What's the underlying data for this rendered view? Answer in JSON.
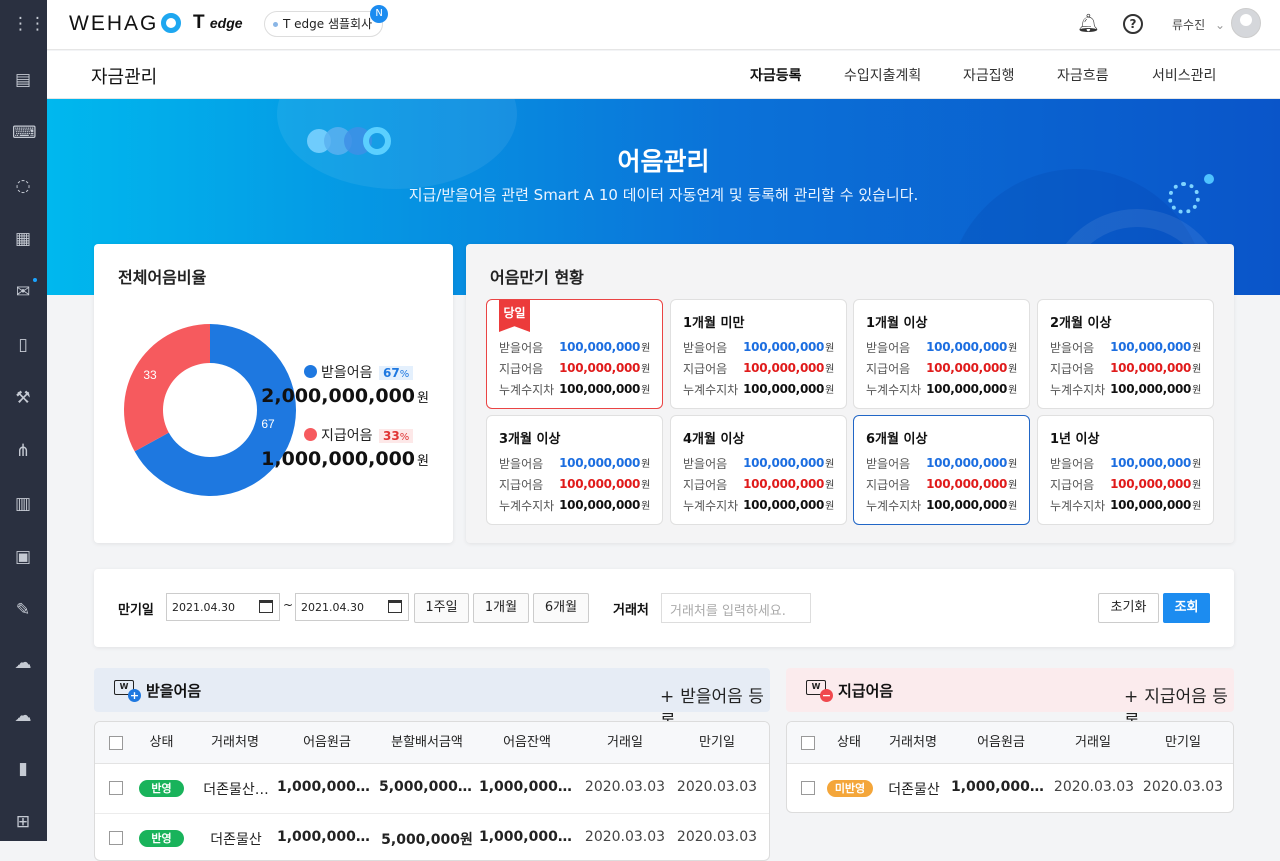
{
  "sidebar": {
    "icons": [
      "apps-icon",
      "report-icon",
      "keyboard-icon",
      "chat-icon",
      "calendar-icon",
      "mail-icon",
      "mobile-icon",
      "hammer-icon",
      "org-chart-icon",
      "building-icon",
      "contacts-icon",
      "book-edit-icon",
      "cloud-icon",
      "cloud-network-icon",
      "notebook-icon",
      "grid-menu-icon"
    ]
  },
  "topbar": {
    "logo": "WEHAG",
    "tedge": "T",
    "tedge_suffix": "edge",
    "company": "T edge 샘플회사",
    "company_badge": "N",
    "user_name": "류수진"
  },
  "subnav": {
    "title": "자금관리",
    "items": [
      "자금등록",
      "수입지출계획",
      "자금집행",
      "자금흐름",
      "서비스관리"
    ]
  },
  "hero": {
    "title": "어음관리",
    "subtitle": "지급/받을어음 관련 Smart A 10 데이터 자동연계 및 등록해 관리할 수 있습니다."
  },
  "ratio_card": {
    "title": "전체어음비율",
    "receivable": {
      "label": "받을어음",
      "percent": "67",
      "unit": "%",
      "amount": "2,000,000,000",
      "won": "원"
    },
    "payable": {
      "label": "지급어음",
      "percent": "33",
      "unit": "%",
      "amount": "1,000,000,000",
      "won": "원"
    },
    "donut_label_blue": "67",
    "donut_label_red": "33"
  },
  "chart_data": {
    "type": "pie",
    "title": "전체어음비율",
    "categories": [
      "받을어음",
      "지급어음"
    ],
    "values": [
      67,
      33
    ],
    "colors": [
      "#1e78e0",
      "#f65a5e"
    ]
  },
  "maturity": {
    "title": "어음만기 현황",
    "row_labels": {
      "receive": "받을어음",
      "pay": "지급어음",
      "cum": "누계수지차",
      "won": "원"
    },
    "cards": [
      {
        "label": "당일",
        "receive": "100,000,000",
        "pay": "100,000,000",
        "cum": "100,000,000"
      },
      {
        "label": "1개월 미만",
        "receive": "100,000,000",
        "pay": "100,000,000",
        "cum": "100,000,000"
      },
      {
        "label": "1개월 이상",
        "receive": "100,000,000",
        "pay": "100,000,000",
        "cum": "100,000,000"
      },
      {
        "label": "2개월 이상",
        "receive": "100,000,000",
        "pay": "100,000,000",
        "cum": "100,000,000"
      },
      {
        "label": "3개월 이상",
        "receive": "100,000,000",
        "pay": "100,000,000",
        "cum": "100,000,000"
      },
      {
        "label": "4개월 이상",
        "receive": "100,000,000",
        "pay": "100,000,000",
        "cum": "100,000,000"
      },
      {
        "label": "6개월 이상",
        "receive": "100,000,000",
        "pay": "100,000,000",
        "cum": "100,000,000"
      },
      {
        "label": "1년 이상",
        "receive": "100,000,000",
        "pay": "100,000,000",
        "cum": "100,000,000"
      }
    ]
  },
  "filter": {
    "due_label": "만기일",
    "date_from": "2021.04.30",
    "tilde": "~",
    "date_to": "2021.04.30",
    "period_buttons": [
      "1주일",
      "1개월",
      "6개월"
    ],
    "client_label": "거래처",
    "client_placeholder": "거래처를 입력하세요.",
    "reset": "초기화",
    "search": "조회"
  },
  "receivable_panel": {
    "title": "받을어음",
    "add": "받을어음 등록",
    "columns": [
      "상태",
      "거래처명",
      "어음원금",
      "분할배서금액",
      "어음잔액",
      "거래일",
      "만기일"
    ],
    "rows": [
      {
        "status": "반영",
        "client": "더존물산…",
        "principal": "1,000,000,…",
        "split": "5,000,000,…",
        "balance": "1,000,000,…",
        "trade": "2020.03.03",
        "due": "2020.03.03"
      },
      {
        "status": "반영",
        "client": "더존물산",
        "principal": "1,000,000,…",
        "split": "5,000,000원",
        "balance": "1,000,000,…",
        "trade": "2020.03.03",
        "due": "2020.03.03"
      }
    ]
  },
  "payable_panel": {
    "title": "지급어음",
    "add": "지급어음 등록",
    "columns": [
      "상태",
      "거래처명",
      "어음원금",
      "거래일",
      "만기일"
    ],
    "rows": [
      {
        "status": "미반영",
        "client": "더존물산",
        "principal": "1,000,000,0…",
        "trade": "2020.03.03",
        "due": "2020.03.03"
      }
    ]
  }
}
